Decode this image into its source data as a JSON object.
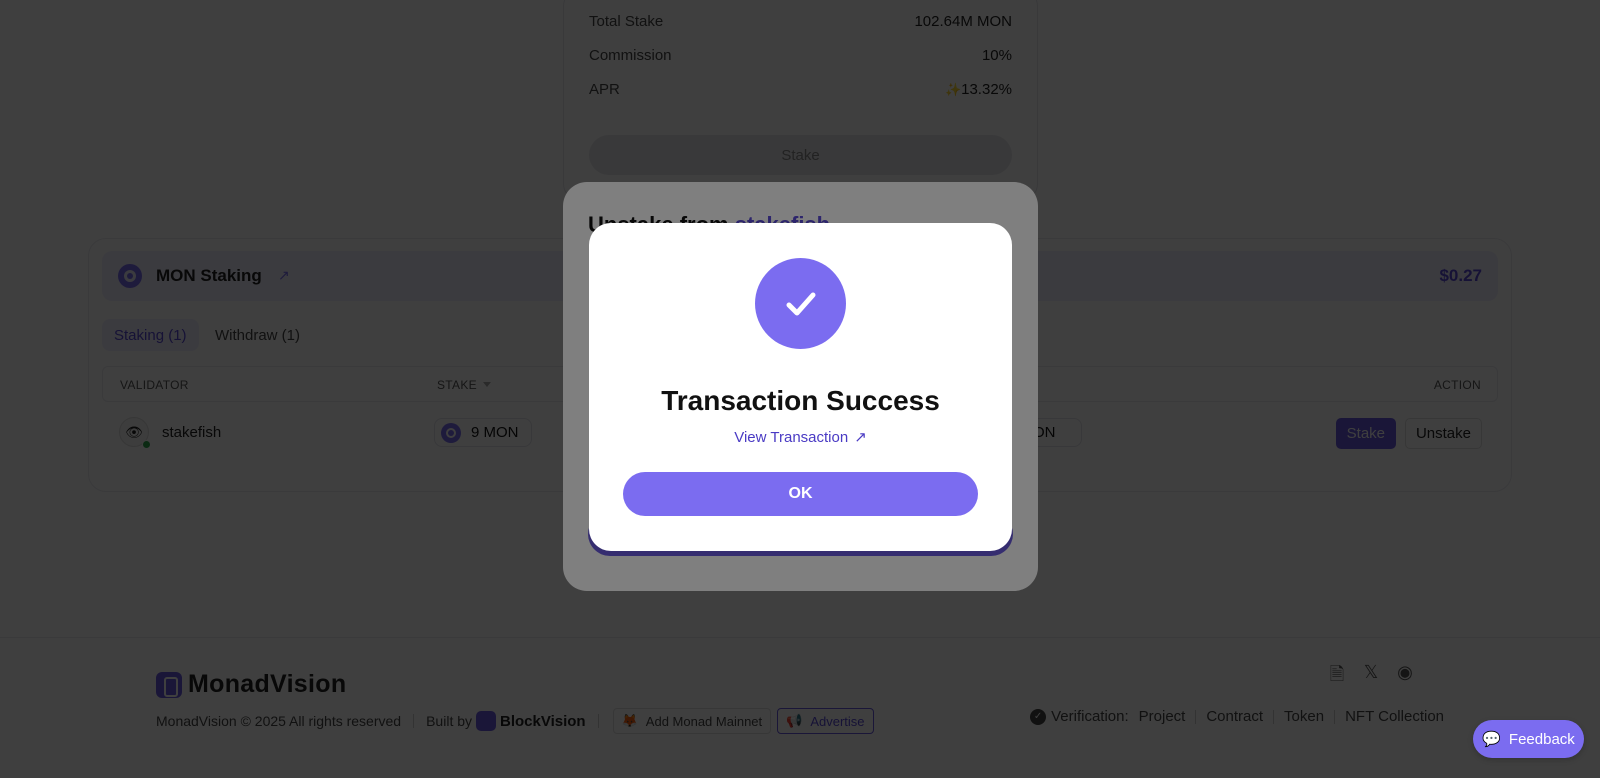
{
  "validator_card": {
    "total_stake_label": "Total Stake",
    "total_stake_value": "102.64M MON",
    "commission_label": "Commission",
    "commission_value": "10%",
    "apr_label": "APR",
    "apr_value": "13.32%",
    "apr_icon": "sparkle-icon",
    "stake_button": "Stake"
  },
  "staking_panel": {
    "title": "MON Staking",
    "value": "$0.27",
    "tabs": [
      {
        "label": "Staking (1)",
        "active": true
      },
      {
        "label": "Withdraw (1)",
        "active": false
      }
    ],
    "columns": {
      "validator": "VALIDATOR",
      "stake": "STAKE",
      "action": "ACTION"
    },
    "rows": [
      {
        "validator": "stakefish",
        "stake": "9 MON",
        "partial_value": "ON",
        "stake_button": "Stake",
        "unstake_button": "Unstake"
      }
    ]
  },
  "unstake_modal": {
    "title_prefix": "Unstake from ",
    "validator_name": "stakefish"
  },
  "success_modal": {
    "title": "Transaction Success",
    "link": "View Transaction",
    "ok_button": "OK"
  },
  "footer": {
    "brand": "MonadVision",
    "copyright": "MonadVision © 2025 All rights reserved",
    "built_by": "Built by",
    "builder": "BlockVision",
    "add_network": "Add Monad Mainnet",
    "advertise": "Advertise",
    "verification_label": "Verification:",
    "verification_links": [
      "Project",
      "Contract",
      "Token",
      "NFT Collection"
    ],
    "social_icons": [
      "docs-icon",
      "x-icon",
      "discord-icon"
    ]
  },
  "feedback_button": "Feedback",
  "colors": {
    "accent": "#7b6cf0",
    "accent_dark": "#6a5ae0",
    "link": "#4a3bc4",
    "online": "#2ea84e"
  }
}
